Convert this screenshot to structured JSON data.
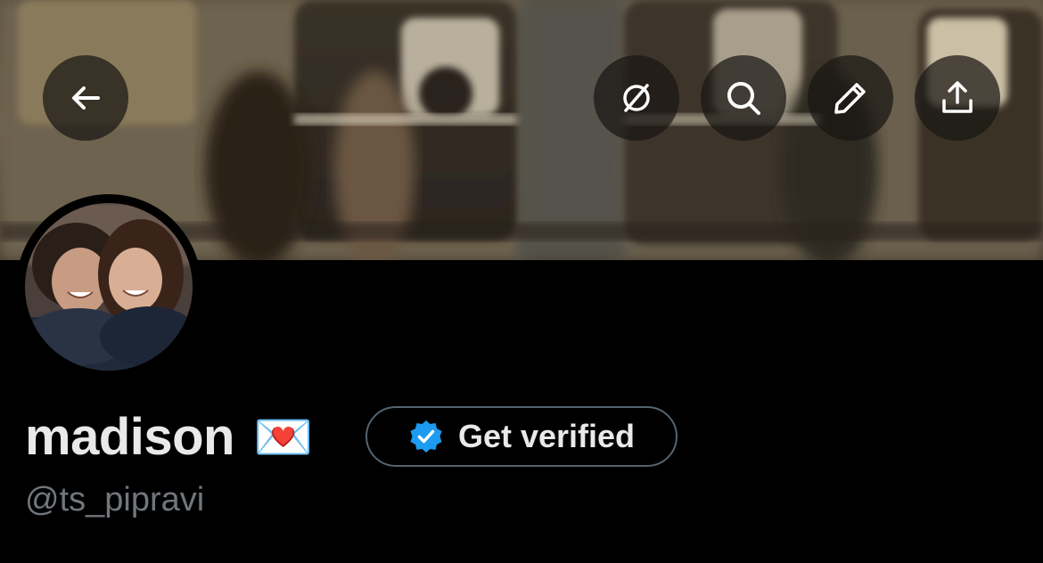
{
  "header": {
    "banner_description": "",
    "buttons": {
      "back": "back-arrow-icon",
      "grok": "grok-icon",
      "search": "search-icon",
      "edit": "pencil-icon",
      "share": "share-icon"
    }
  },
  "profile": {
    "display_name": "madison",
    "name_emoji": "💌",
    "handle": "@ts_pipravi"
  },
  "verify_button": {
    "label": "Get verified",
    "badge_color": "#1d9bf0"
  },
  "colors": {
    "background": "#000000",
    "text_primary": "#e7e9ea",
    "text_secondary": "#71767b",
    "border": "#536471"
  }
}
